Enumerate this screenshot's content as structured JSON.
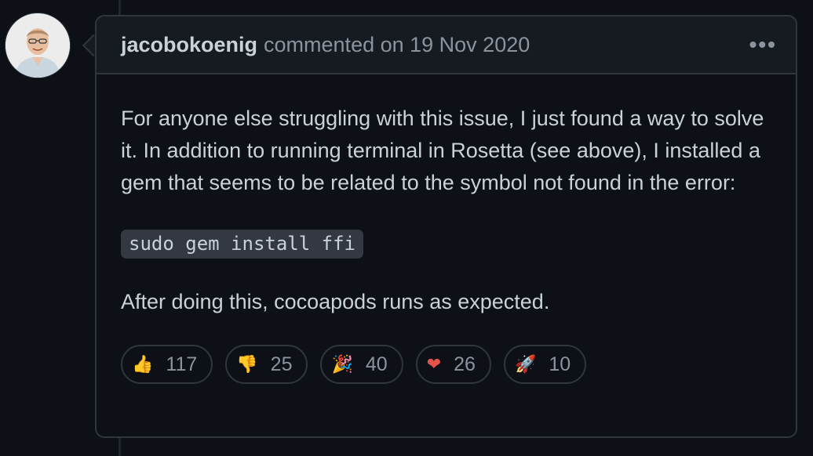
{
  "comment": {
    "author": "jacobokoenig",
    "meta": "commented on 19 Nov 2020",
    "more_label": "•••",
    "paragraph1": "For anyone else struggling with this issue, I just found a way to solve it. In addition to running terminal in Rosetta (see above), I installed a gem that seems to be related to the symbol not found in the error:",
    "code": "sudo gem install ffi",
    "paragraph2": "After doing this, cocoapods runs as expected."
  },
  "reactions": [
    {
      "icon": "thumbs-up-icon",
      "emoji": "👍",
      "count": "117"
    },
    {
      "icon": "thumbs-down-icon",
      "emoji": "👎",
      "count": "25"
    },
    {
      "icon": "party-popper-icon",
      "emoji": "🎉",
      "count": "40"
    },
    {
      "icon": "heart-icon",
      "emoji": "❤",
      "count": "26"
    },
    {
      "icon": "rocket-icon",
      "emoji": "🚀",
      "count": "10"
    }
  ]
}
